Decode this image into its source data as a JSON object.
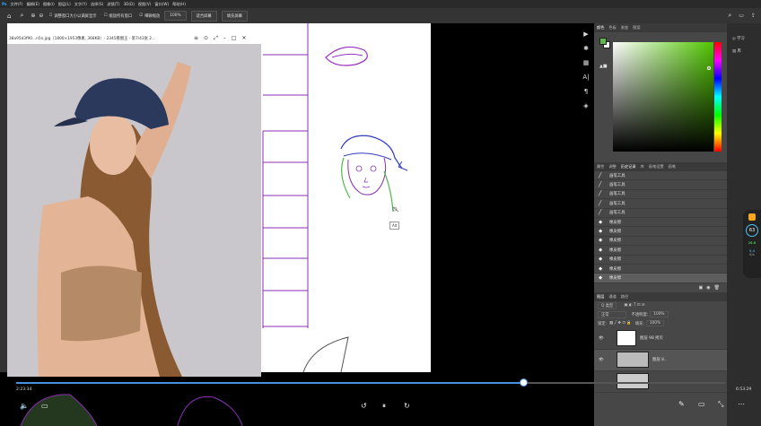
{
  "menubar": {
    "items": [
      "文件(F)",
      "编辑(E)",
      "图像(I)",
      "图层(L)",
      "文字(Y)",
      "选择(S)",
      "滤镜(T)",
      "3D(D)",
      "视图(V)",
      "窗口(W)",
      "帮助(H)"
    ]
  },
  "options": {
    "resize_windows": "调整窗口大小以满屏显示",
    "zoom_all": "缩放所有窗口",
    "scrubby_zoom": "细微缩放",
    "zoom_level": "100%",
    "fit_screen": "适合屏幕",
    "fill_screen": "填充屏幕"
  },
  "video": {
    "title": "38a95d3f90...n5n.jpg（1800×1953像素, 368KB）- 2345看图王 - 第7/43张 2..."
  },
  "color_panel": {
    "tabs": [
      "颜色",
      "色板",
      "渐变",
      "图案"
    ],
    "foreground": "#5fb84a",
    "background": "#ffffff",
    "hue": "#4fc400"
  },
  "history_panel": {
    "tabs": [
      "属性",
      "调整",
      "历史记录",
      "库",
      "画笔设置",
      "画笔"
    ],
    "active_tab": "历史记录",
    "rows": [
      {
        "label": "画笔工具",
        "icon": "brush"
      },
      {
        "label": "画笔工具",
        "icon": "brush"
      },
      {
        "label": "画笔工具",
        "icon": "brush"
      },
      {
        "label": "画笔工具",
        "icon": "brush"
      },
      {
        "label": "画笔工具",
        "icon": "brush"
      },
      {
        "label": "橡皮擦",
        "icon": "eraser"
      },
      {
        "label": "橡皮擦",
        "icon": "eraser"
      },
      {
        "label": "橡皮擦",
        "icon": "eraser"
      },
      {
        "label": "橡皮擦",
        "icon": "eraser"
      },
      {
        "label": "橡皮擦",
        "icon": "eraser"
      },
      {
        "label": "橡皮擦",
        "icon": "eraser"
      },
      {
        "label": "橡皮擦",
        "icon": "eraser"
      }
    ]
  },
  "layers_panel": {
    "tabs": [
      "图层",
      "通道",
      "路径"
    ],
    "filter": "Q 类型",
    "blend_mode": "正常",
    "opacity_label": "不透明度:",
    "opacity": "100%",
    "lock_label": "锁定:",
    "fill_label": "填充:",
    "fill": "100%",
    "layers": [
      {
        "name": "图层 98 拷贝"
      },
      {
        "name": "图层 8.."
      },
      {
        "name": ""
      }
    ]
  },
  "right_col": {
    "learn": "学习",
    "lib": "库"
  },
  "side_widget": {
    "badge": "63",
    "up": "26.6",
    "down": "5.4",
    "unit": "K/s"
  },
  "player": {
    "elapsed": "2:23:34",
    "total": "6:53:29",
    "progress_pct": 71.5
  },
  "canvas_tooltip": "Alt"
}
